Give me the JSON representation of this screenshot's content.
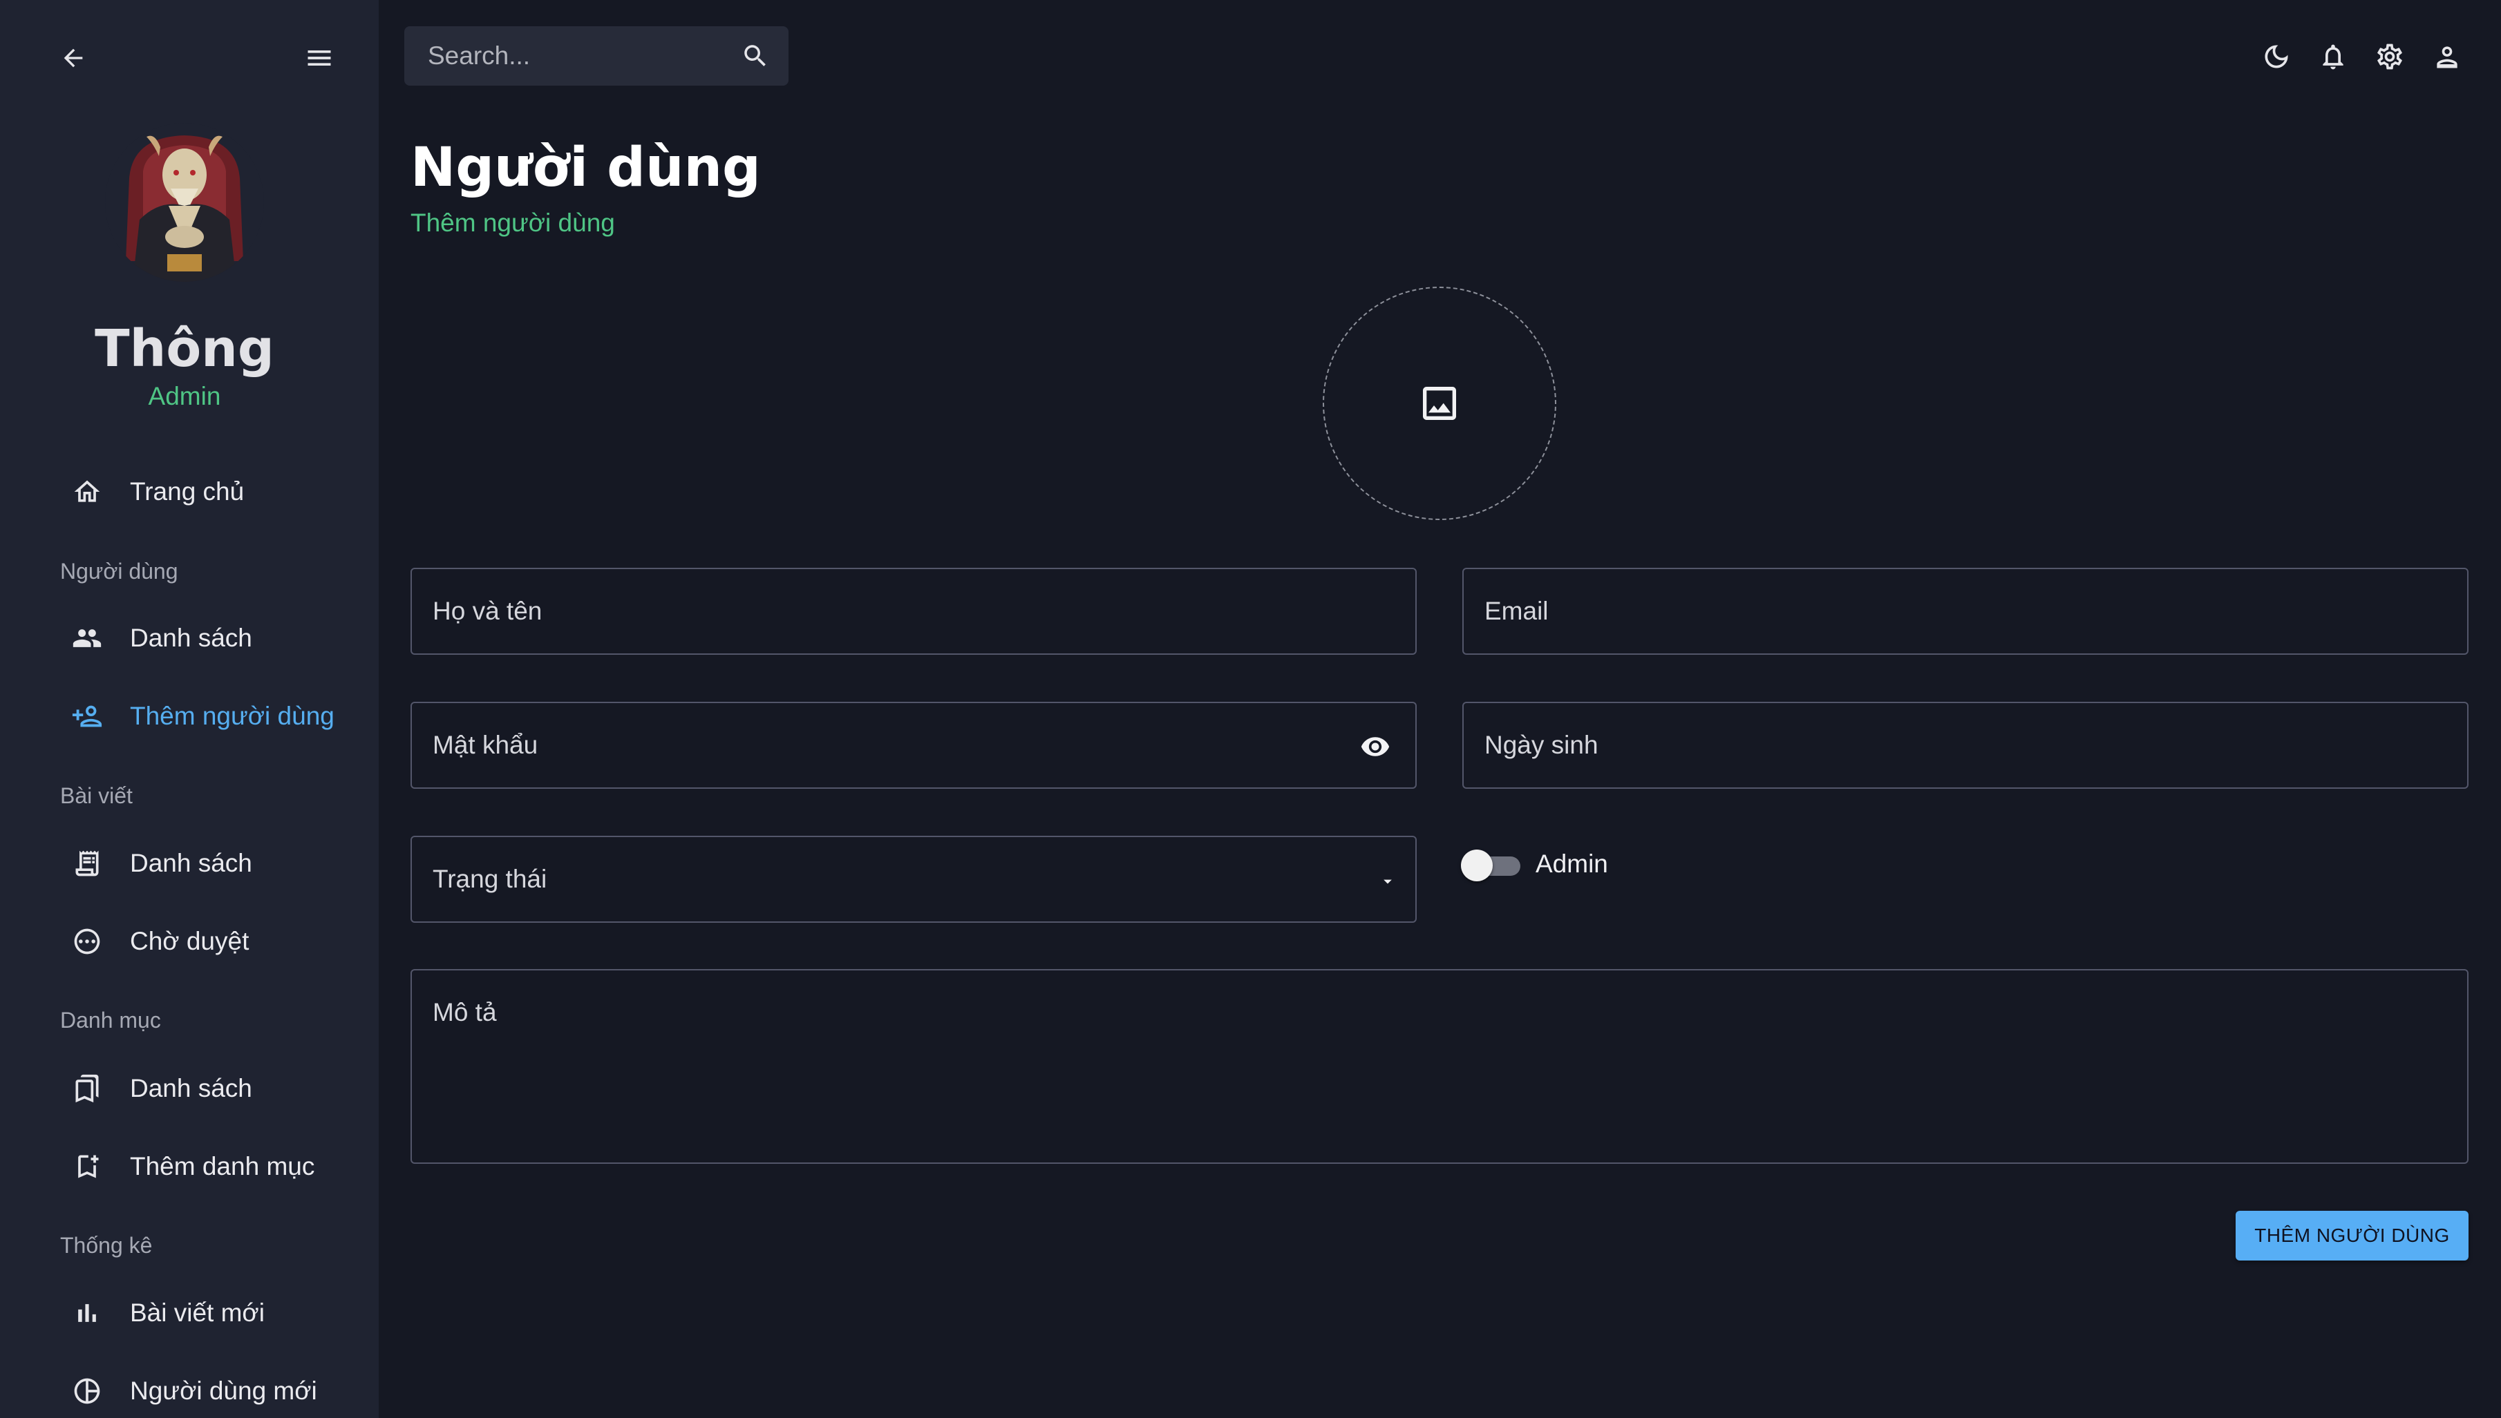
{
  "colors": {
    "background": "#151823",
    "sidebar": "#1f2331",
    "accent_blue": "#56aef0",
    "accent_green": "#4fc585",
    "button": "#57aef5"
  },
  "sidebar": {
    "profile": {
      "name": "Thông",
      "role": "Admin"
    },
    "home": {
      "label": "Trang chủ",
      "icon": "home-icon"
    },
    "sections": [
      {
        "label": "Người dùng",
        "items": [
          {
            "label": "Danh sách",
            "icon": "people-icon"
          },
          {
            "label": "Thêm người dùng",
            "icon": "person-add-icon",
            "active": true
          }
        ]
      },
      {
        "label": "Bài viết",
        "items": [
          {
            "label": "Danh sách",
            "icon": "receipt-icon"
          },
          {
            "label": "Chờ duyệt",
            "icon": "pending-icon"
          }
        ]
      },
      {
        "label": "Danh mục",
        "items": [
          {
            "label": "Danh sách",
            "icon": "bookmarks-icon"
          },
          {
            "label": "Thêm danh mục",
            "icon": "bookmark-add-icon"
          }
        ]
      },
      {
        "label": "Thống kê",
        "items": [
          {
            "label": "Bài viết mới",
            "icon": "bar-chart-icon"
          },
          {
            "label": "Người dùng mới",
            "icon": "pie-chart-icon"
          }
        ]
      }
    ]
  },
  "topbar": {
    "search_placeholder": "Search...",
    "icons": [
      "dark-mode-icon",
      "notifications-icon",
      "settings-icon",
      "account-icon"
    ]
  },
  "main": {
    "title": "Người dùng",
    "subtitle": "Thêm người dùng",
    "form": {
      "full_name": "Họ và tên",
      "email": "Email",
      "password": "Mật khẩu",
      "birthday": "Ngày sinh",
      "status": "Trạng thái",
      "admin_toggle": {
        "label": "Admin",
        "checked": false
      },
      "description": "Mô tả",
      "submit": "THÊM NGƯỜI DÙNG"
    }
  }
}
